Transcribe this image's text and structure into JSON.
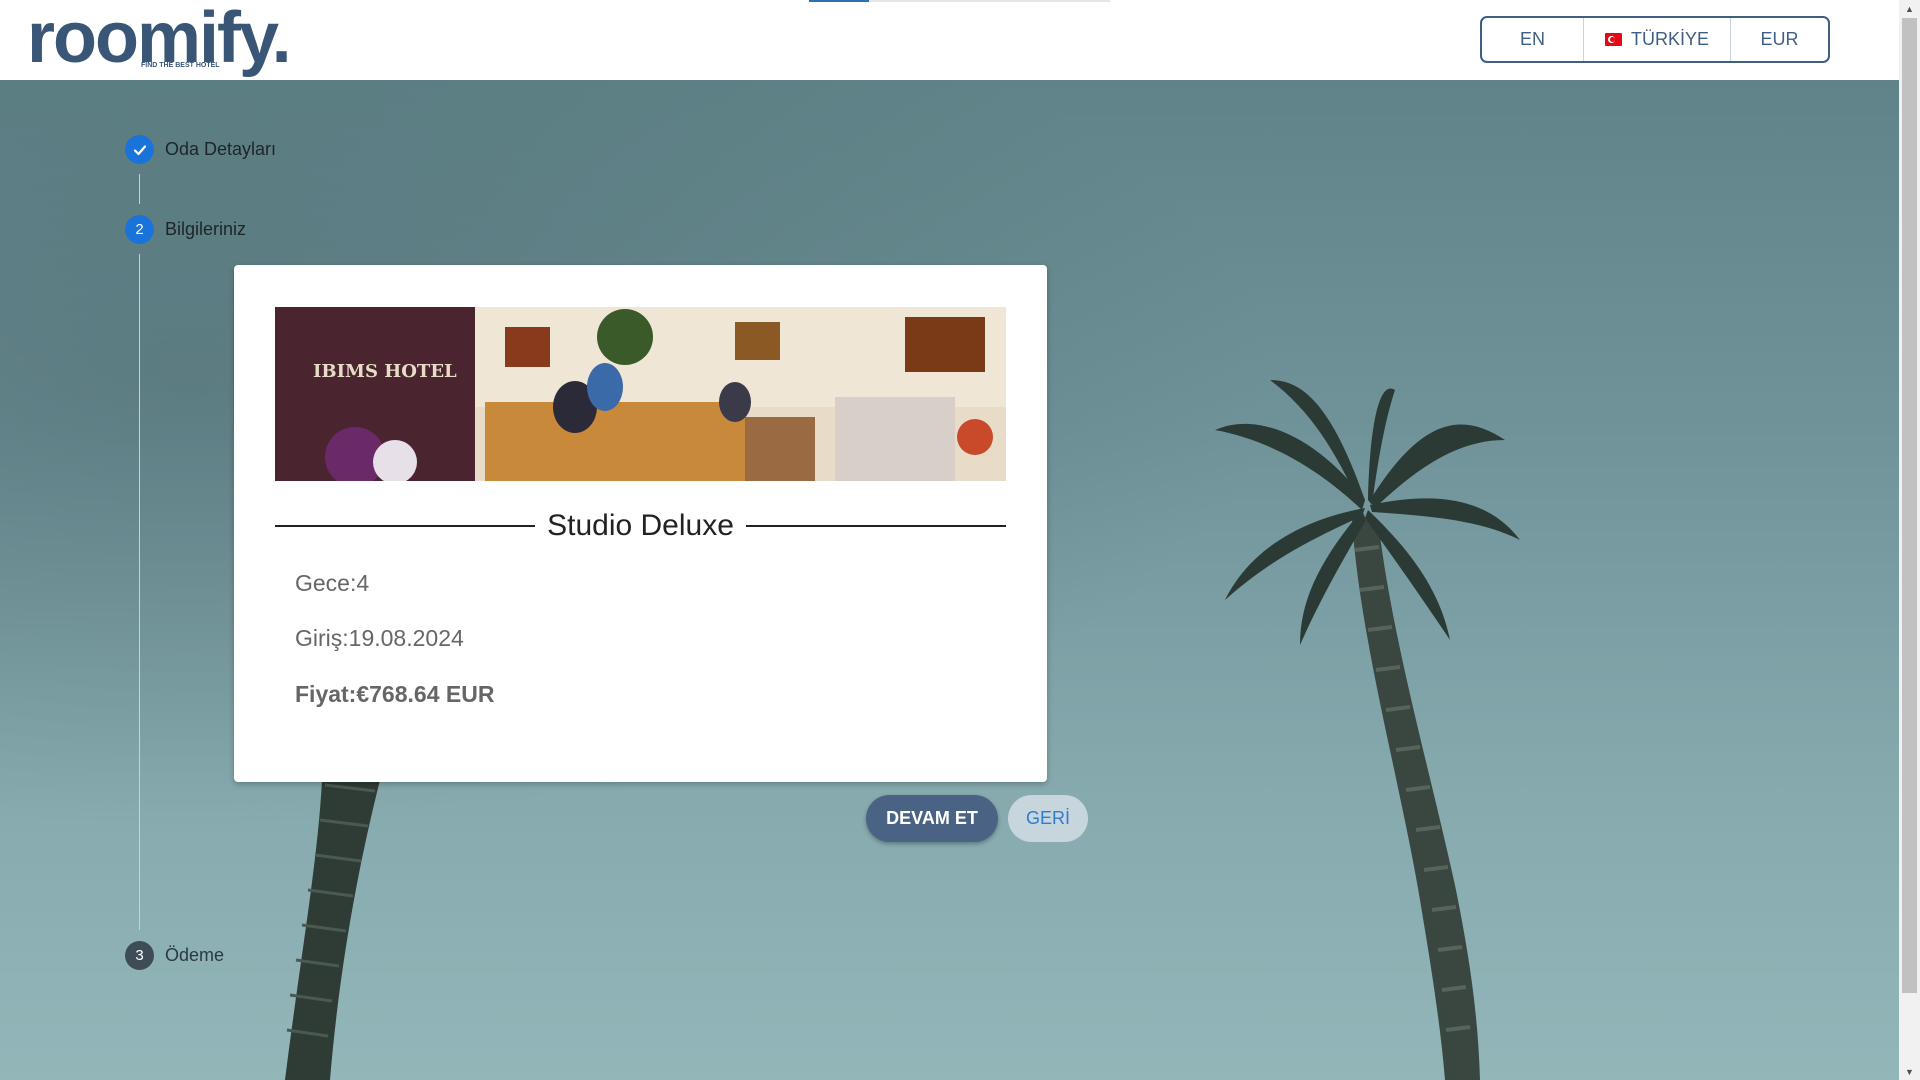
{
  "brand": {
    "name": "roomify.",
    "tagline": "FIND THE BEST HOTEL"
  },
  "locale": {
    "language": "EN",
    "country": "TÜRKİYE",
    "country_flag_icon": "turkey-flag-icon",
    "currency": "EUR"
  },
  "stepper": {
    "steps": [
      {
        "number": "",
        "label": "Oda Detayları",
        "state": "done",
        "icon": "check-icon"
      },
      {
        "number": "2",
        "label": "Bilgileriniz",
        "state": "active"
      },
      {
        "number": "3",
        "label": "Ödeme",
        "state": "pending"
      }
    ]
  },
  "room": {
    "title": "Studio Deluxe",
    "nights": "Gece:4",
    "checkin": "Giriş:19.08.2024",
    "price": "Fiyat:€768.64 EUR",
    "image_sign_text": "IBIMS HOTEL"
  },
  "actions": {
    "continue_label": "DEVAM ET",
    "back_label": "GERİ"
  },
  "colors": {
    "brand": "#3a5677",
    "step_active": "#1a73d9",
    "step_pending": "#3e4d55",
    "continue_button": "#4a6384",
    "back_button": "#c7d6dc"
  }
}
